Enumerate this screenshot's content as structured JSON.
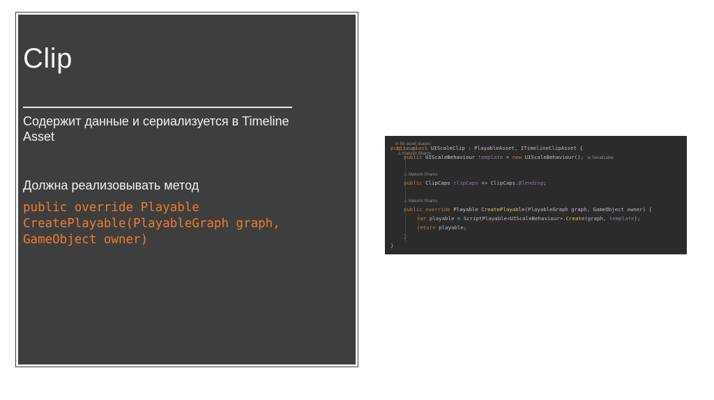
{
  "slide": {
    "title": "Clip",
    "description": "Содержит данные и сериализуется в Timeline Asset",
    "must_label": "Должна реализовывать метод",
    "signature_line1": "public override Playable",
    "signature_line2": "CreatePlayable(PlayableGraph graph,",
    "signature_line3": "GameObject owner)"
  },
  "code": {
    "hint_usages": "No asset usages",
    "hint_usage_count": "1 usage",
    "hint_author": "Maksim Sharov",
    "hint_author2": "Maksim Sharov",
    "hint_author3": "Maksim Sharov",
    "hint_serializable": "Serializable",
    "l1_kw": "public class ",
    "l1_name": "UIScaleClip",
    "l1_rest": " : PlayableAsset, ITimelineClipAsset {",
    "l2_kw": "public ",
    "l2_type": "UIScaleBehaviour ",
    "l2_field": "template",
    "l2_eq": " = ",
    "l2_new": "new ",
    "l2_rest": "UIScaleBehaviour();",
    "l4_kw": "public ",
    "l4_type": "ClipCaps ",
    "l4_field": "clipCaps",
    "l4_mid": " => ClipCaps.",
    "l4_it": "Blending",
    "l4_end": ";",
    "l6_kw": "public override ",
    "l6_type": "Playable ",
    "l6_fn": "CreatePlayable",
    "l6_rest": "(PlayableGraph graph, GameObject owner) {",
    "l7_kw": "var ",
    "l7_mid": "playable = ScriptPlayable<UIScaleBehaviour>.",
    "l7_fn": "Create",
    "l7_a": "(graph, ",
    "l7_field": "template",
    "l7_end": ");",
    "l8_kw": "return ",
    "l8_rest": "playable;",
    "l9": "}",
    "l10": "}"
  },
  "colors": {
    "panel_bg": "#3e3e3e",
    "code_bg": "#2b2b2b",
    "accent_orange": "#ed7d31"
  }
}
